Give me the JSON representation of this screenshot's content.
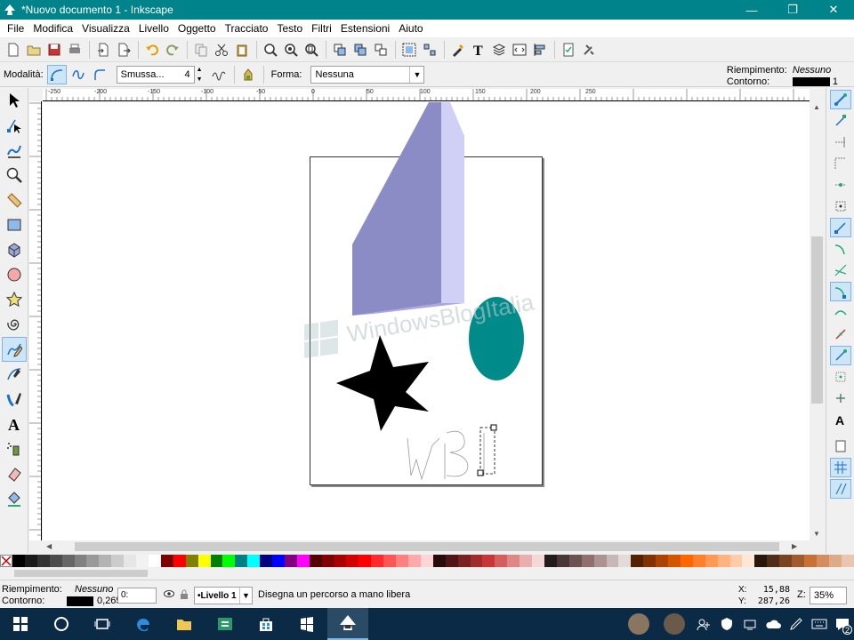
{
  "window": {
    "title": "*Nuovo documento 1 - Inkscape",
    "minimize": "—",
    "maximize": "❐",
    "close": "✕"
  },
  "menu": [
    "File",
    "Modifica",
    "Visualizza",
    "Livello",
    "Oggetto",
    "Tracciato",
    "Testo",
    "Filtri",
    "Estensioni",
    "Aiuto"
  ],
  "tool_controls": {
    "mode_label": "Modalità:",
    "smoothing_value": "Smussa...",
    "smoothing_number": "4",
    "shape_label": "Forma:",
    "shape_value": "Nessuna",
    "fill_label": "Riempimento:",
    "fill_value": "Nessuno",
    "stroke_label": "Contorno:",
    "stroke_width": "1"
  },
  "ruler_top_labels": [
    "-250",
    "-200",
    "-150",
    "-100",
    "-50",
    "0",
    "50",
    "100",
    "150",
    "200",
    "250"
  ],
  "watermark": "WindowsBlogItalia",
  "colors": {
    "titlebar": "#00838a",
    "parallelogram_front": "#8b8bc6",
    "parallelogram_side": "#d0d0f7",
    "ellipse": "#008b8b",
    "star": "#000000"
  },
  "palette": [
    "#000000",
    "#1a1a1a",
    "#333333",
    "#4d4d4d",
    "#666666",
    "#808080",
    "#999999",
    "#b3b3b3",
    "#cccccc",
    "#e6e6e6",
    "#f2f2f2",
    "#ffffff",
    "#800000",
    "#ff0000",
    "#808000",
    "#ffff00",
    "#008000",
    "#00ff00",
    "#008080",
    "#00ffff",
    "#000080",
    "#0000ff",
    "#800080",
    "#ff00ff",
    "#550000",
    "#800000",
    "#aa0000",
    "#d40000",
    "#ff0000",
    "#ff2a2a",
    "#ff5555",
    "#ff8080",
    "#ffaaaa",
    "#ffd5d5",
    "#280b0b",
    "#501616",
    "#782121",
    "#a02c2c",
    "#c83737",
    "#d35f5f",
    "#de8787",
    "#e9afaf",
    "#f4d7d7",
    "#241c1c",
    "#483737",
    "#6c5353",
    "#916f6f",
    "#ac9393",
    "#c8b7b7",
    "#e3dbdb",
    "#552200",
    "#803300",
    "#aa4400",
    "#d45500",
    "#ff6600",
    "#ff7f2a",
    "#ff9955",
    "#ffb380",
    "#ffccaa",
    "#ffe6d5",
    "#28170b",
    "#502d16",
    "#784421",
    "#a05a2c",
    "#c87137",
    "#d38d5f",
    "#deaa87",
    "#e9c6af"
  ],
  "status": {
    "fill_label": "Riempimento:",
    "fill_value": "Nessuno",
    "stroke_label": "Contorno:",
    "stroke_width": "0,265",
    "opacity": "0:",
    "layer": "•Livello 1",
    "message": "Disegna un percorso a mano libera",
    "x_label": "X:",
    "x_value": "15,88",
    "y_label": "Y:",
    "y_value": "287,26",
    "zoom_label": "Z:",
    "zoom_value": "35%"
  },
  "taskbar": {
    "notification_count": "2"
  }
}
